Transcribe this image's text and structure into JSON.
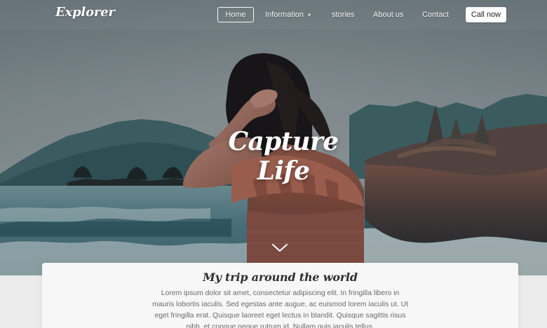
{
  "brand": {
    "logo": "Explorer"
  },
  "nav": {
    "home": "Home",
    "information": "Information",
    "stories": "stories",
    "about": "About us",
    "contact": "Contact",
    "cta": "Call now"
  },
  "hero": {
    "title": "Capture Life"
  },
  "card": {
    "title": "My trip around the world",
    "lines": [
      "Lorem ipsum dolor sit amet, consectetur adipiscing elit. In fringilla libero in",
      "mauris lobortis iaculis. Sed egestas ante augue, ac euismod lorem iaculis ut. Ut",
      "eget fringilla erat. Quisque laoreet eget lectus in blandit. Quisque sagittis risus",
      "nibh, et congue neque rutrum id. Nullam quis iaculis tellus."
    ]
  },
  "icons": {
    "dropdown": "chevron-down-icon",
    "scroll": "chevron-down-icon"
  },
  "colors": {
    "nav_text": "#f3f3f3",
    "cta_bg": "#ffffff",
    "card_bg": "#f7f7f7",
    "body_text": "#6a6a6a"
  }
}
